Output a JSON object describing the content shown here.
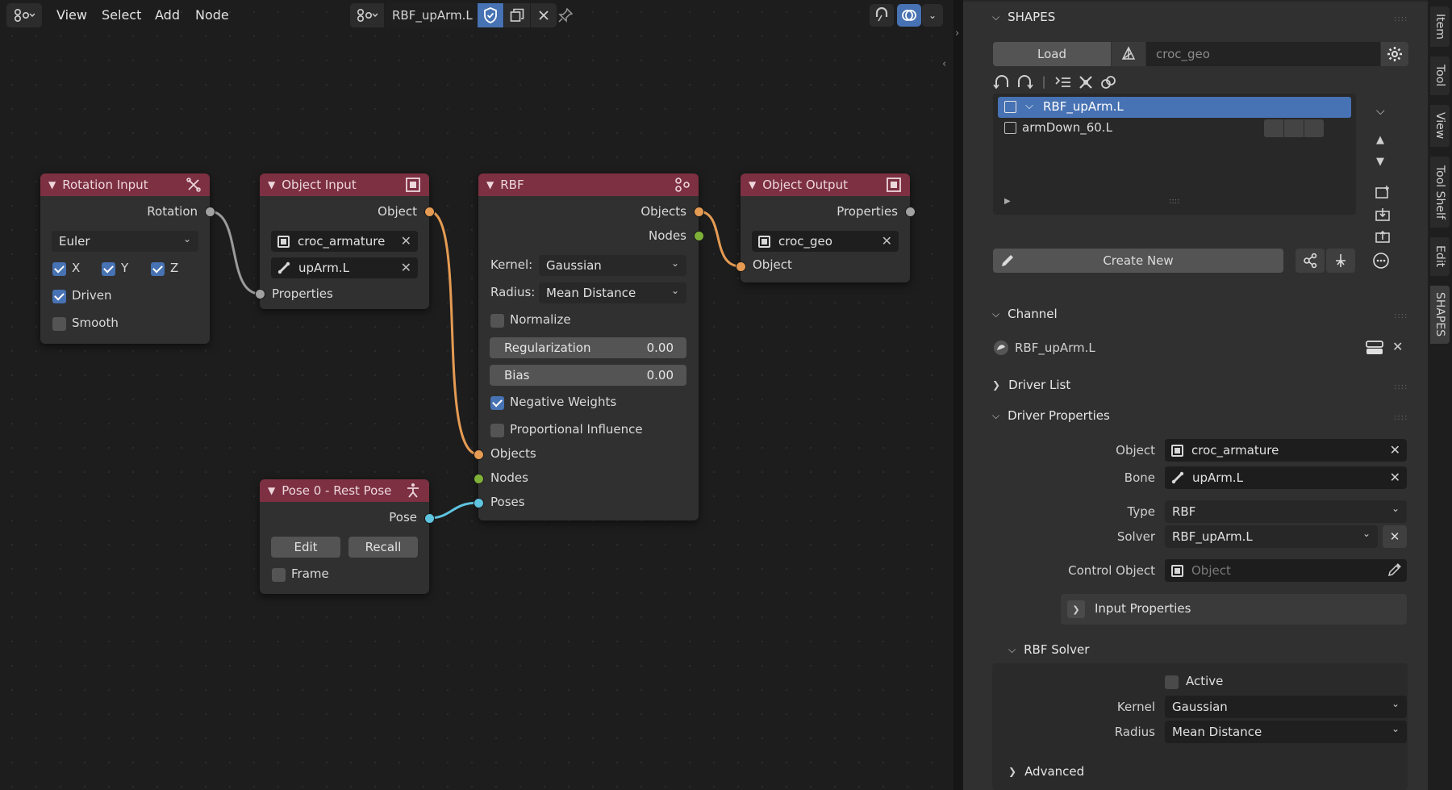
{
  "menubar": {
    "view": "View",
    "select": "Select",
    "add": "Add",
    "node": "Node",
    "tree_name": "RBF_upArm.L"
  },
  "nodes": {
    "rotation_input": {
      "title": "Rotation Input",
      "out_rotation": "Rotation",
      "mode": "Euler",
      "x": "X",
      "y": "Y",
      "z": "Z",
      "driven": "Driven",
      "smooth": "Smooth"
    },
    "object_input": {
      "title": "Object Input",
      "out_object": "Object",
      "object": "croc_armature",
      "bone": "upArm.L",
      "in_properties": "Properties"
    },
    "rbf": {
      "title": "RBF",
      "out_objects": "Objects",
      "out_nodes": "Nodes",
      "kernel_label": "Kernel:",
      "kernel": "Gaussian",
      "radius_label": "Radius:",
      "radius": "Mean Distance",
      "normalize": "Normalize",
      "regularization_label": "Regularization",
      "regularization": "0.00",
      "bias_label": "Bias",
      "bias": "0.00",
      "negative_weights": "Negative Weights",
      "proportional_influence": "Proportional Influence",
      "in_objects": "Objects",
      "in_nodes": "Nodes",
      "in_poses": "Poses"
    },
    "object_output": {
      "title": "Object Output",
      "out_properties": "Properties",
      "object": "croc_geo",
      "in_object": "Object"
    },
    "pose0": {
      "title": "Pose 0 - Rest Pose",
      "out_pose": "Pose",
      "edit": "Edit",
      "recall": "Recall",
      "frame": "Frame"
    }
  },
  "sidebar": {
    "shapes_header": "SHAPES",
    "load": "Load",
    "target": "croc_geo",
    "list": [
      {
        "name": "RBF_upArm.L",
        "selected": true
      },
      {
        "name": "armDown_60.L",
        "selected": false
      }
    ],
    "create_new": "Create New",
    "channel_header": "Channel",
    "channel_name": "RBF_upArm.L",
    "driver_list_header": "Driver List",
    "driver_props_header": "Driver Properties",
    "object_label": "Object",
    "object_value": "croc_armature",
    "bone_label": "Bone",
    "bone_value": "upArm.L",
    "type_label": "Type",
    "type_value": "RBF",
    "solver_label": "Solver",
    "solver_value": "RBF_upArm.L",
    "control_object_label": "Control Object",
    "control_object_placeholder": "Object",
    "input_properties": "Input Properties",
    "rbf_solver_header": "RBF Solver",
    "active_label": "Active",
    "kernel_label": "Kernel",
    "kernel_value": "Gaussian",
    "radius_label": "Radius",
    "radius_value": "Mean Distance",
    "advanced": "Advanced"
  },
  "tabs": [
    "Item",
    "Tool",
    "View",
    "Tool Shelf",
    "Edit",
    "SHAPES"
  ],
  "colors": {
    "node_header": "#7d3042",
    "selected_row": "#4772b3",
    "socket_grey": "#a1a1a1",
    "socket_orange": "#e59b53",
    "socket_green": "#7fb138",
    "socket_cyan": "#5fc4e0"
  }
}
